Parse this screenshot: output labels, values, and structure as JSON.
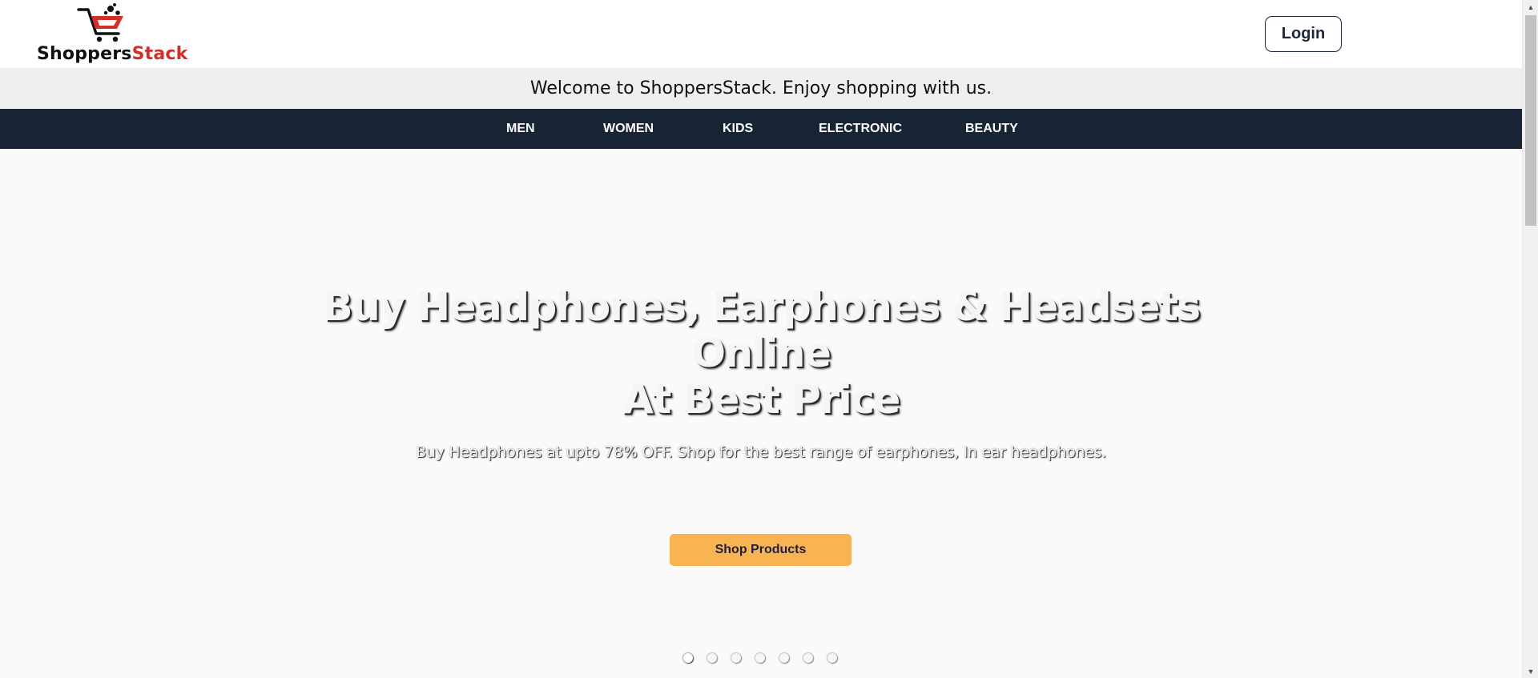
{
  "brand": {
    "name_part1": "Shoppers",
    "name_part2": "Stack",
    "logo_icon": "shopping-cart-icon"
  },
  "header": {
    "login_label": "Login"
  },
  "welcome": {
    "text": "Welcome to ShoppersStack. Enjoy shopping with us."
  },
  "nav": {
    "items": [
      {
        "label": "MEN"
      },
      {
        "label": "WOMEN"
      },
      {
        "label": "KIDS"
      },
      {
        "label": "ELECTRONIC"
      },
      {
        "label": "BEAUTY"
      }
    ]
  },
  "hero": {
    "title_line1": "Buy Headphones, Earphones & Headsets Online",
    "title_line2": "At Best Price",
    "subtitle": "Buy Headphones at upto 78% OFF. Shop for the best range of earphones, In ear headphones.",
    "cta_label": "Shop Products",
    "slide_count": 7,
    "active_slide": 1
  },
  "colors": {
    "navbar_bg": "#182335",
    "welcome_bg": "#efefef",
    "cta_bg": "#f8b453",
    "brand_red": "#d22f27"
  }
}
